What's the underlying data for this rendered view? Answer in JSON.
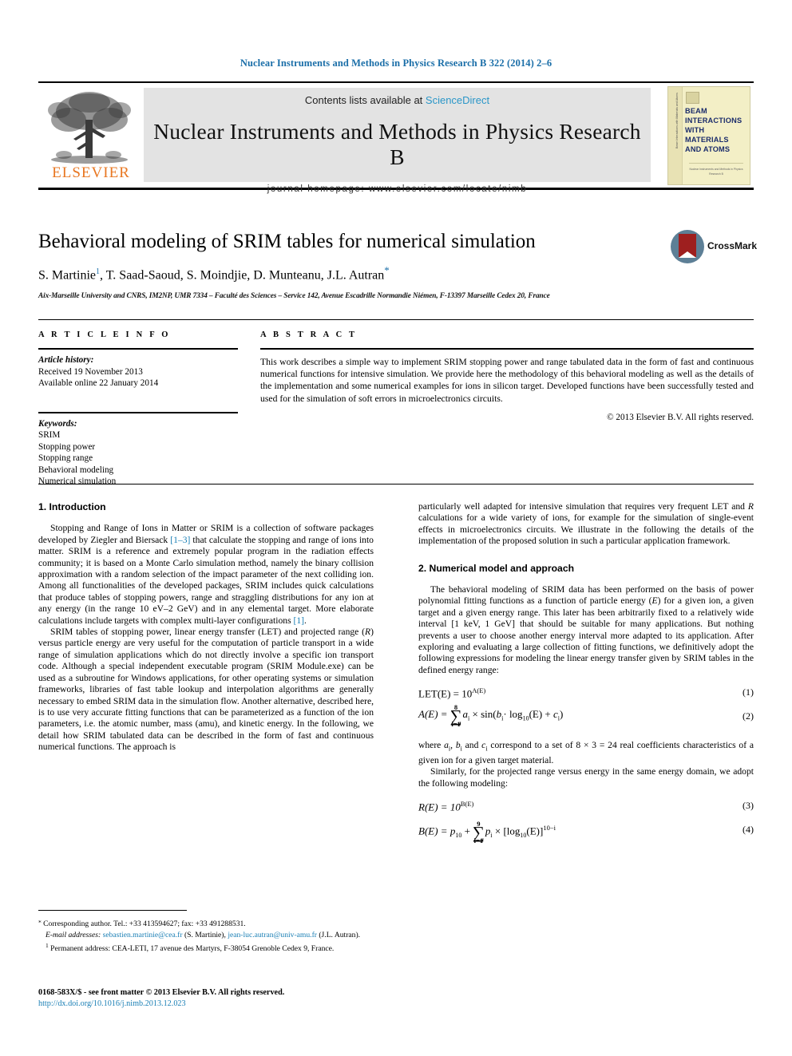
{
  "running_head": "Nuclear Instruments and Methods in Physics Research B 322 (2014) 2–6",
  "masthead": {
    "contents_prefix": "Contents lists available at ",
    "sciencedirect": "ScienceDirect",
    "journal_title": "Nuclear Instruments and Methods in Physics Research B",
    "homepage": "journal homepage: www.elsevier.com/locate/nimb",
    "publisher": "ELSEVIER",
    "cover": {
      "title": "BEAM INTERACTIONS WITH MATERIALS AND ATOMS",
      "spine": "Beam Interactions with Materials and Atoms",
      "footer": "Nuclear Instruments and Methods in Physics Research B"
    }
  },
  "article": {
    "title": "Behavioral modeling of SRIM tables for numerical simulation",
    "authors": "S. Martinie, T. Saad-Saoud, S. Moindjie, D. Munteanu, J.L. Autran",
    "author_parts": {
      "a1": "S. Martinie",
      "a1_sup": "1",
      "rest": ", T. Saad-Saoud, S. Moindjie, D. Munteanu, J.L. Autran",
      "corresponding_star": "*"
    },
    "affiliation": "Aix-Marseille University and CNRS, IM2NP, UMR 7334 – Faculté des Sciences – Service 142, Avenue Escadrille Normandie Niémen, F-13397 Marseille Cedex 20, France",
    "crossmark_label": "CrossMark"
  },
  "article_info": {
    "heading": "A R T I C L E   I N F O",
    "history_label": "Article history:",
    "received": "Received 19 November 2013",
    "available": "Available online 22 January 2014",
    "keywords_label": "Keywords:",
    "keywords": [
      "SRIM",
      "Stopping power",
      "Stopping range",
      "Behavioral modeling",
      "Numerical simulation"
    ]
  },
  "abstract": {
    "heading": "A B S T R A C T",
    "text": "This work describes a simple way to implement SRIM stopping power and range tabulated data in the form of fast and continuous numerical functions for intensive simulation. We provide here the methodology of this behavioral modeling as well as the details of the implementation and some numerical examples for ions in silicon target. Developed functions have been successfully tested and used for the simulation of soft errors in microelectronics circuits.",
    "copyright": "© 2013 Elsevier B.V. All rights reserved."
  },
  "sections": {
    "intro_heading": "1. Introduction",
    "intro_p1_a": "Stopping and Range of Ions in Matter or SRIM is a collection of software packages developed by Ziegler and Biersack ",
    "intro_p1_ref1": "[1–3]",
    "intro_p1_b": " that calculate the stopping and range of ions into matter. SRIM is a reference and extremely popular program in the radiation effects community; it is based on a Monte Carlo simulation method, namely the binary collision approximation with a random selection of the impact parameter of the next colliding ion. Among all functionalities of the developed packages, SRIM includes quick calculations that produce tables of stopping powers, range and straggling distributions for any ion at any energy (in the range 10 eV–2 GeV) and in any elemental target. More elaborate calculations include targets with complex multi-layer configurations ",
    "intro_p1_ref2": "[1]",
    "intro_p1_c": ".",
    "intro_p2_a": "SRIM tables of stopping power, linear energy transfer (LET) and projected range (",
    "intro_p2_R": "R",
    "intro_p2_b": ") versus particle energy are very useful for the computation of particle transport in a wide range of simulation applications which do not directly involve a specific ion transport code. Although a special independent executable program (SRIM Module.exe) can be used as a subroutine for Windows applications, for other operating systems or simulation frameworks, libraries of fast table lookup and interpolation algorithms are generally necessary to embed SRIM data in the simulation flow. Another alternative, described here, is to use very accurate fitting functions that can be parameterized as a function of the ion parameters, i.e. the atomic number, mass (amu), and kinetic energy. In the following, we detail how SRIM tabulated data can be described in the form of fast and continuous numerical functions. The approach is",
    "right_cont_a": "particularly well adapted for intensive simulation that requires very frequent LET and ",
    "right_cont_R": "R",
    "right_cont_b": " calculations for a wide variety of ions, for example for the simulation of single-event effects in microelectronics circuits. We illustrate in the following the details of the implementation of the proposed solution in such a particular application framework.",
    "model_heading": "2. Numerical model and approach",
    "model_p1_a": "The behavioral modeling of SRIM data has been performed on the basis of power polynomial fitting functions as a function of particle energy (",
    "model_p1_E": "E",
    "model_p1_b": ") for a given ion, a given target and a given energy range. This later has been arbitrarily fixed to a relatively wide interval [1 keV, 1 GeV] that should be suitable for many applications. But nothing prevents a user to choose another energy interval more adapted to its application. After exploring and evaluating a large collection of fitting functions, we definitively adopt the following expressions for modeling the linear energy transfer given by SRIM tables in the defined energy range:",
    "after_eq2_a": "where ",
    "after_eq2_b": " correspond to a set of 8 × 3 = 24 real coefficients characteristics of a given ion for a given target material.",
    "after_eq2_sym1": "a",
    "after_eq2_sym2": "b",
    "after_eq2_sym3": "c",
    "after_eq2_sub": "i",
    "before_eq3": "Similarly, for the projected range versus energy in the same energy domain, we adopt the following modeling:"
  },
  "equations": {
    "eq1": {
      "lhs": "LET(E) = 10",
      "exp": "A(E)",
      "number": "(1)"
    },
    "eq2": {
      "lhs": "A(E) =",
      "sum_top": "8",
      "sum_bot": "i=1",
      "body_a": "a",
      "body_sub_a": "i",
      "times": "× sin(",
      "body_b": "b",
      "body_sub_b": "i",
      "mid": "· log",
      "log_base": "10",
      "tail": "(E) + ",
      "body_c": "c",
      "body_sub_c": "i",
      "close": ")",
      "number": "(2)"
    },
    "eq3": {
      "lhs": "R(E) = 10",
      "exp": "B(E)",
      "number": "(3)"
    },
    "eq4": {
      "lhs": "B(E) = p",
      "lhs_sub": "10",
      "plus": "+",
      "sum_top": "9",
      "sum_bot": "i=1",
      "body_p": "p",
      "body_sub": "i",
      "times": "× [log",
      "log_base": "10",
      "tail": "(E)]",
      "tail_exp": "10−i",
      "number": "(4)"
    }
  },
  "footnotes": {
    "corresponding": "Corresponding author. Tel.: +33 413594627; fax: +33 491288531.",
    "corresponding_star": "⁎",
    "email_label": "E-mail addresses:",
    "email1": "sebastien.martinie@cea.fr",
    "email1_who": " (S. Martinie), ",
    "email2": "jean-luc.autran@univ-amu.fr",
    "email2_who": " (J.L. Autran).",
    "permanent_sup": "1",
    "permanent": "Permanent address: CEA-LETI, 17 avenue des Martyrs, F-38054 Grenoble Cedex 9, France."
  },
  "colophon": {
    "issn_line": "0168-583X/$ - see front matter © 2013 Elsevier B.V. All rights reserved.",
    "doi": "http://dx.doi.org/10.1016/j.nimb.2013.12.023"
  },
  "colors": {
    "link": "#1a7fb5",
    "running_head": "#1a6ea8",
    "elsevier_orange": "#E87722",
    "sciencedirect": "#2a96c8",
    "crossmark_red": "#9e1f1f",
    "crossmark_blue": "#5d7f96"
  }
}
